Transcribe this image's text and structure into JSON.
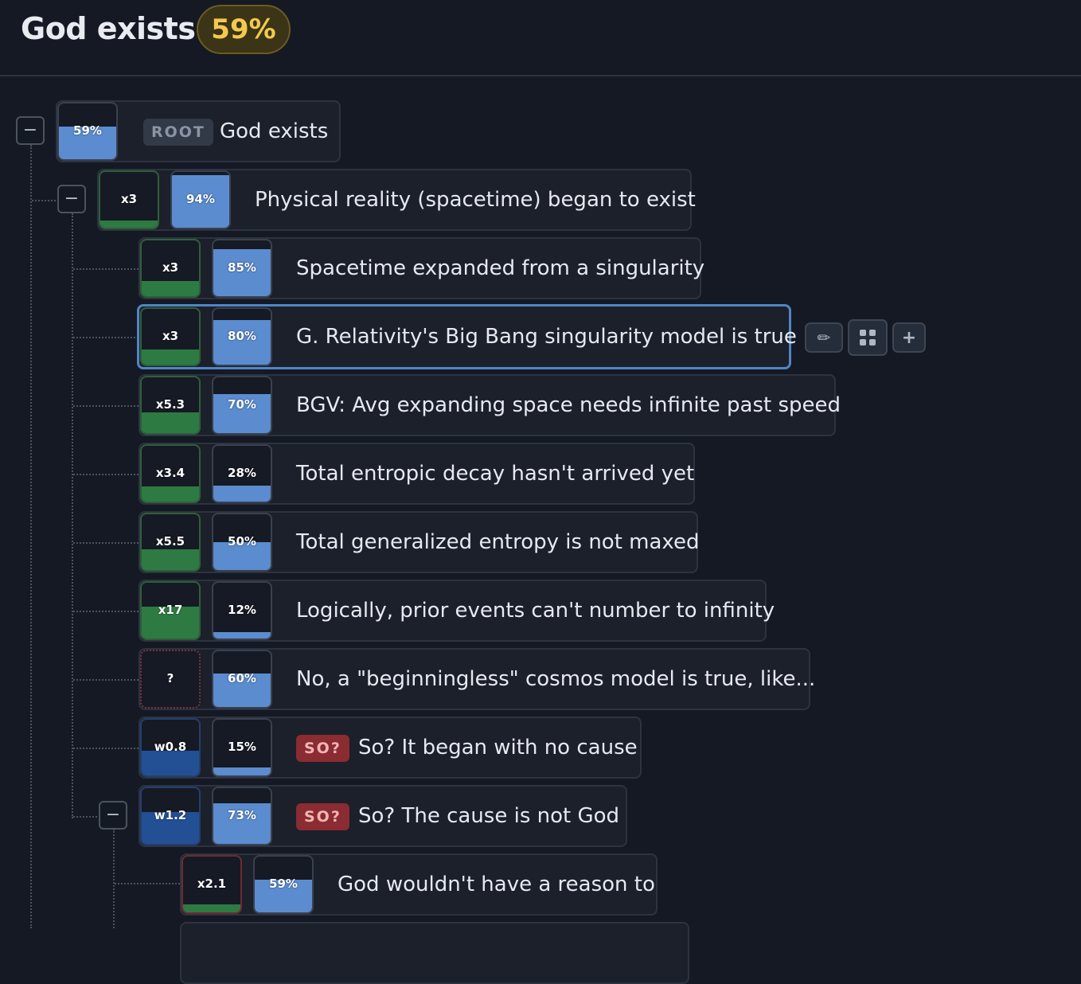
{
  "header": {
    "title": "God exists",
    "badge": "59%"
  },
  "toggle_symbol": "−",
  "actions": {
    "edit_icon": "✏",
    "grid_icon": "grid-icon",
    "add_label": "+"
  },
  "colors": {
    "probability": "#5b8ccf",
    "multiplier": "#2e7a43",
    "weight": "#234f95",
    "badge": "#f3c94e"
  },
  "nodes": [
    {
      "tag": "ROOT",
      "text": "God exists",
      "prob": "59%",
      "prob_value": 0.59,
      "mult": null,
      "mult_value": null,
      "mult_type": "none"
    },
    {
      "tag": "",
      "text": "Physical reality (spacetime) began to exist",
      "prob": "94%",
      "prob_value": 0.94,
      "mult": "x3",
      "mult_value": 0.13,
      "mult_type": "mult"
    },
    {
      "tag": "",
      "text": "Spacetime expanded from a singularity",
      "prob": "85%",
      "prob_value": 0.85,
      "mult": "x3",
      "mult_value": 0.27,
      "mult_type": "mult"
    },
    {
      "tag": "",
      "text": "G. Relativity's Big Bang singularity model is true",
      "prob": "80%",
      "prob_value": 0.8,
      "mult": "x3",
      "mult_value": 0.27,
      "mult_type": "mult"
    },
    {
      "tag": "",
      "text": "BGV: Avg expanding space needs infinite past speed",
      "prob": "70%",
      "prob_value": 0.7,
      "mult": "x5.3",
      "mult_value": 0.37,
      "mult_type": "mult"
    },
    {
      "tag": "",
      "text": "Total entropic decay hasn't arrived yet",
      "prob": "28%",
      "prob_value": 0.28,
      "mult": "x3.4",
      "mult_value": 0.27,
      "mult_type": "mult"
    },
    {
      "tag": "",
      "text": "Total generalized entropy is not maxed",
      "prob": "50%",
      "prob_value": 0.5,
      "mult": "x5.5",
      "mult_value": 0.37,
      "mult_type": "mult"
    },
    {
      "tag": "",
      "text": "Logically, prior events can't number to infinity",
      "prob": "12%",
      "prob_value": 0.12,
      "mult": "x17",
      "mult_value": 0.57,
      "mult_type": "mult"
    },
    {
      "tag": "",
      "text": "No, a \"beginningless\" cosmos model is true, like...",
      "prob": "60%",
      "prob_value": 0.6,
      "mult": "?",
      "mult_value": 0,
      "mult_type": "unknown"
    },
    {
      "tag": "SO?",
      "text": "So? It began with no cause",
      "prob": "15%",
      "prob_value": 0.15,
      "mult": "w0.8",
      "mult_value": 0.45,
      "mult_type": "weight"
    },
    {
      "tag": "SO?",
      "text": "So? The cause is not God",
      "prob": "73%",
      "prob_value": 0.73,
      "mult": "w1.2",
      "mult_value": 0.57,
      "mult_type": "weight"
    },
    {
      "tag": "",
      "text": "God wouldn't have a reason to",
      "prob": "59%",
      "prob_value": 0.59,
      "mult": "x2.1",
      "mult_value": 0.15,
      "mult_type": "mult-neg"
    }
  ]
}
